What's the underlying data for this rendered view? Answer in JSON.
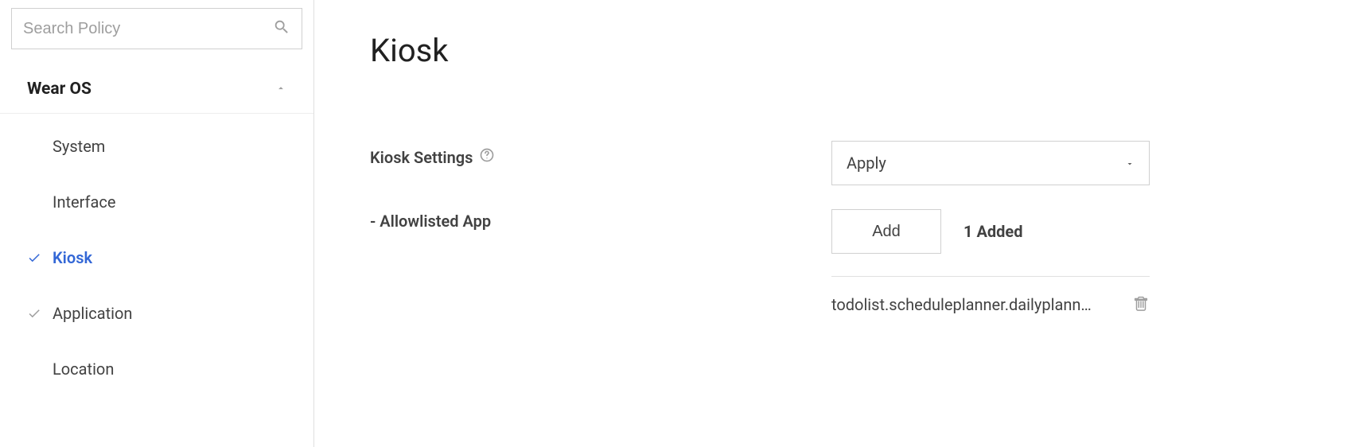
{
  "sidebar": {
    "search_placeholder": "Search Policy",
    "group_title": "Wear OS",
    "items": [
      {
        "label": "System",
        "active": false,
        "checked": false
      },
      {
        "label": "Interface",
        "active": false,
        "checked": false
      },
      {
        "label": "Kiosk",
        "active": true,
        "checked": true
      },
      {
        "label": "Application",
        "active": false,
        "checked": true
      },
      {
        "label": "Location",
        "active": false,
        "checked": false
      }
    ]
  },
  "main": {
    "page_title": "Kiosk",
    "kiosk_settings_label": "Kiosk Settings",
    "kiosk_settings_value": "Apply",
    "allowlisted_label": "- Allowlisted App",
    "add_button": "Add",
    "added_count_label": "1 Added",
    "app_item": "todolist.scheduleplanner.dailyplann…"
  }
}
